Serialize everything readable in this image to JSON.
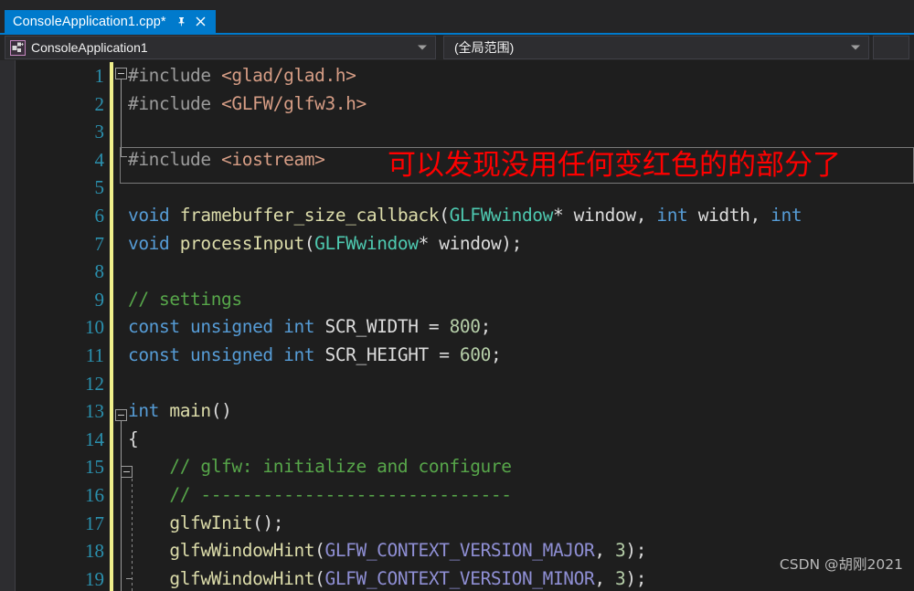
{
  "window": {
    "theme_background": "#1e1e1e",
    "accent": "#007acc"
  },
  "tabstrip": {
    "active_tab": {
      "label": "ConsoleApplication1.cpp*",
      "pin_icon": "pin-icon",
      "close_icon": "close-icon"
    }
  },
  "navbar": {
    "project_icon": "cpp-project-icon",
    "project_selector": {
      "value": "ConsoleApplication1",
      "dropdown_icon": "chevron-down-icon"
    },
    "scope_selector": {
      "value": "(全局范围)",
      "dropdown_icon": "chevron-down-icon"
    }
  },
  "editor": {
    "lines": [
      {
        "num": "1",
        "changed": true,
        "tokens": [
          {
            "t": "#include ",
            "c": "t-pre"
          },
          {
            "t": "<glad/glad.h>",
            "c": "t-str"
          }
        ]
      },
      {
        "num": "2",
        "changed": true,
        "tokens": [
          {
            "t": "#include ",
            "c": "t-pre"
          },
          {
            "t": "<GLFW/glfw3.h>",
            "c": "t-str"
          }
        ]
      },
      {
        "num": "3",
        "changed": true,
        "tokens": []
      },
      {
        "num": "4",
        "changed": true,
        "tokens": [
          {
            "t": "#include ",
            "c": "t-pre"
          },
          {
            "t": "<iostream>",
            "c": "t-str"
          }
        ]
      },
      {
        "num": "5",
        "changed": true,
        "tokens": []
      },
      {
        "num": "6",
        "changed": true,
        "tokens": [
          {
            "t": "void",
            "c": "t-kw"
          },
          {
            "t": " ",
            "c": "t-plain"
          },
          {
            "t": "framebuffer_size_callback",
            "c": "t-fn"
          },
          {
            "t": "(",
            "c": "t-punc"
          },
          {
            "t": "GLFWwindow",
            "c": "t-type"
          },
          {
            "t": "* window, ",
            "c": "t-plain"
          },
          {
            "t": "int",
            "c": "t-kw"
          },
          {
            "t": " width, ",
            "c": "t-plain"
          },
          {
            "t": "int",
            "c": "t-kw"
          }
        ]
      },
      {
        "num": "7",
        "changed": true,
        "tokens": [
          {
            "t": "void",
            "c": "t-kw"
          },
          {
            "t": " ",
            "c": "t-plain"
          },
          {
            "t": "processInput",
            "c": "t-fn"
          },
          {
            "t": "(",
            "c": "t-punc"
          },
          {
            "t": "GLFWwindow",
            "c": "t-type"
          },
          {
            "t": "* window);",
            "c": "t-plain"
          }
        ]
      },
      {
        "num": "8",
        "changed": true,
        "tokens": []
      },
      {
        "num": "9",
        "changed": true,
        "tokens": [
          {
            "t": "// settings",
            "c": "t-com"
          }
        ]
      },
      {
        "num": "10",
        "changed": true,
        "tokens": [
          {
            "t": "const",
            "c": "t-kw"
          },
          {
            "t": " ",
            "c": "t-plain"
          },
          {
            "t": "unsigned",
            "c": "t-kw"
          },
          {
            "t": " ",
            "c": "t-plain"
          },
          {
            "t": "int",
            "c": "t-kw"
          },
          {
            "t": " SCR_WIDTH = ",
            "c": "t-plain"
          },
          {
            "t": "800",
            "c": "t-num"
          },
          {
            "t": ";",
            "c": "t-plain"
          }
        ]
      },
      {
        "num": "11",
        "changed": true,
        "tokens": [
          {
            "t": "const",
            "c": "t-kw"
          },
          {
            "t": " ",
            "c": "t-plain"
          },
          {
            "t": "unsigned",
            "c": "t-kw"
          },
          {
            "t": " ",
            "c": "t-plain"
          },
          {
            "t": "int",
            "c": "t-kw"
          },
          {
            "t": " SCR_HEIGHT = ",
            "c": "t-plain"
          },
          {
            "t": "600",
            "c": "t-num"
          },
          {
            "t": ";",
            "c": "t-plain"
          }
        ]
      },
      {
        "num": "12",
        "changed": true,
        "tokens": []
      },
      {
        "num": "13",
        "changed": true,
        "tokens": [
          {
            "t": "int",
            "c": "t-kw"
          },
          {
            "t": " ",
            "c": "t-plain"
          },
          {
            "t": "main",
            "c": "t-fn"
          },
          {
            "t": "()",
            "c": "t-punc"
          }
        ]
      },
      {
        "num": "14",
        "changed": true,
        "tokens": [
          {
            "t": "{",
            "c": "t-punc"
          }
        ]
      },
      {
        "num": "15",
        "changed": true,
        "tokens": [
          {
            "t": "    // glfw: initialize and configure",
            "c": "t-com"
          }
        ]
      },
      {
        "num": "16",
        "changed": true,
        "tokens": [
          {
            "t": "    // ------------------------------",
            "c": "t-com"
          }
        ]
      },
      {
        "num": "17",
        "changed": true,
        "tokens": [
          {
            "t": "    ",
            "c": "t-plain"
          },
          {
            "t": "glfwInit",
            "c": "t-fn"
          },
          {
            "t": "();",
            "c": "t-punc"
          }
        ]
      },
      {
        "num": "18",
        "changed": true,
        "tokens": [
          {
            "t": "    ",
            "c": "t-plain"
          },
          {
            "t": "glfwWindowHint",
            "c": "t-fn"
          },
          {
            "t": "(",
            "c": "t-punc"
          },
          {
            "t": "GLFW_CONTEXT_VERSION_MAJOR",
            "c": "t-mac"
          },
          {
            "t": ", ",
            "c": "t-plain"
          },
          {
            "t": "3",
            "c": "t-num"
          },
          {
            "t": ");",
            "c": "t-punc"
          }
        ]
      },
      {
        "num": "19",
        "changed": true,
        "tokens": [
          {
            "t": "    ",
            "c": "t-plain"
          },
          {
            "t": "glfwWindowHint",
            "c": "t-fn"
          },
          {
            "t": "(",
            "c": "t-punc"
          },
          {
            "t": "GLFW_CONTEXT_VERSION_MINOR",
            "c": "t-mac"
          },
          {
            "t": ", ",
            "c": "t-plain"
          },
          {
            "t": "3",
            "c": "t-num"
          },
          {
            "t": ");",
            "c": "t-punc"
          }
        ]
      }
    ]
  },
  "annotation": {
    "text": "可以发现没用任何变红色的的部分了",
    "color": "#ff0000"
  },
  "watermark": {
    "text": "CSDN @胡刚2021"
  }
}
